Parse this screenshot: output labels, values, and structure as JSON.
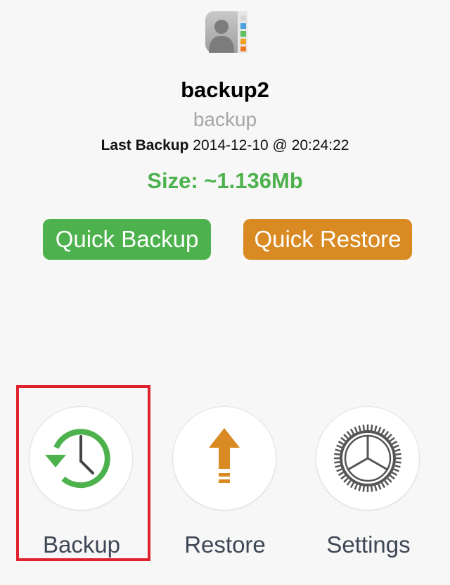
{
  "backup": {
    "name": "backup2",
    "subtitle": "backup",
    "last_backup_label": "Last Backup",
    "last_backup_value": "2014-12-10 @ 20:24:22",
    "size_text": "Size: ~1.136Mb"
  },
  "actions": {
    "quick_backup_label": "Quick Backup",
    "quick_restore_label": "Quick Restore"
  },
  "tabs": [
    {
      "label": "Backup",
      "icon": "backup-clock-icon",
      "highlighted": true
    },
    {
      "label": "Restore",
      "icon": "upload-arrow-icon",
      "highlighted": false
    },
    {
      "label": "Settings",
      "icon": "gear-icon",
      "highlighted": false
    }
  ],
  "colors": {
    "green": "#4db24d",
    "orange": "#d98a22",
    "highlight": "#e0212e",
    "gear": "#555555"
  }
}
